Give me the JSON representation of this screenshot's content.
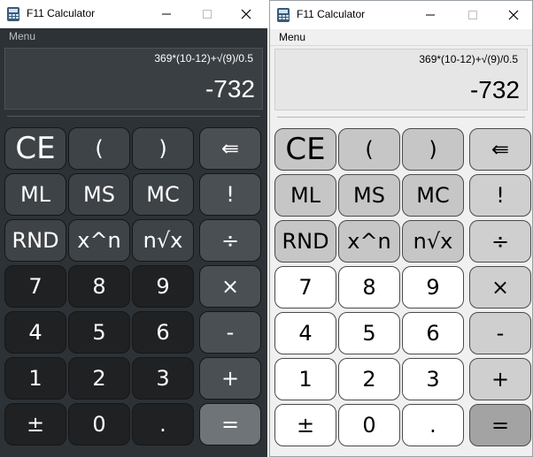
{
  "windows": [
    {
      "theme": "dark",
      "title": "F11 Calculator",
      "menu": "Menu",
      "display": {
        "expression": "369*(10-12)+√(9)/0.5",
        "result": "-732"
      },
      "keys": [
        {
          "label": "CE",
          "kind": "top"
        },
        {
          "label": "(",
          "kind": "top"
        },
        {
          "label": ")",
          "kind": "top"
        },
        {
          "label": "⇚",
          "kind": "op"
        },
        {
          "label": "ML",
          "kind": "top"
        },
        {
          "label": "MS",
          "kind": "top"
        },
        {
          "label": "MC",
          "kind": "top"
        },
        {
          "label": "!",
          "kind": "op"
        },
        {
          "label": "RND",
          "kind": "top"
        },
        {
          "label": "x^n",
          "kind": "top"
        },
        {
          "label": "n√x",
          "kind": "top"
        },
        {
          "label": "÷",
          "kind": "op"
        },
        {
          "label": "7",
          "kind": "num"
        },
        {
          "label": "8",
          "kind": "num"
        },
        {
          "label": "9",
          "kind": "num"
        },
        {
          "label": "×",
          "kind": "op"
        },
        {
          "label": "4",
          "kind": "num"
        },
        {
          "label": "5",
          "kind": "num"
        },
        {
          "label": "6",
          "kind": "num"
        },
        {
          "label": "-",
          "kind": "op"
        },
        {
          "label": "1",
          "kind": "num"
        },
        {
          "label": "2",
          "kind": "num"
        },
        {
          "label": "3",
          "kind": "num"
        },
        {
          "label": "+",
          "kind": "op"
        },
        {
          "label": "±",
          "kind": "num"
        },
        {
          "label": "0",
          "kind": "num"
        },
        {
          "label": ".",
          "kind": "num"
        },
        {
          "label": "=",
          "kind": "eq"
        }
      ]
    },
    {
      "theme": "light",
      "title": "F11 Calculator",
      "menu": "Menu",
      "display": {
        "expression": "369*(10-12)+√(9)/0.5",
        "result": "-732"
      },
      "keys": [
        {
          "label": "CE",
          "kind": "top"
        },
        {
          "label": "(",
          "kind": "top"
        },
        {
          "label": ")",
          "kind": "top"
        },
        {
          "label": "⇚",
          "kind": "op"
        },
        {
          "label": "ML",
          "kind": "top"
        },
        {
          "label": "MS",
          "kind": "top"
        },
        {
          "label": "MC",
          "kind": "top"
        },
        {
          "label": "!",
          "kind": "op"
        },
        {
          "label": "RND",
          "kind": "top"
        },
        {
          "label": "x^n",
          "kind": "top"
        },
        {
          "label": "n√x",
          "kind": "top"
        },
        {
          "label": "÷",
          "kind": "op"
        },
        {
          "label": "7",
          "kind": "num"
        },
        {
          "label": "8",
          "kind": "num"
        },
        {
          "label": "9",
          "kind": "num"
        },
        {
          "label": "×",
          "kind": "op"
        },
        {
          "label": "4",
          "kind": "num"
        },
        {
          "label": "5",
          "kind": "num"
        },
        {
          "label": "6",
          "kind": "num"
        },
        {
          "label": "-",
          "kind": "op"
        },
        {
          "label": "1",
          "kind": "num"
        },
        {
          "label": "2",
          "kind": "num"
        },
        {
          "label": "3",
          "kind": "num"
        },
        {
          "label": "+",
          "kind": "op"
        },
        {
          "label": "±",
          "kind": "num"
        },
        {
          "label": "0",
          "kind": "num"
        },
        {
          "label": ".",
          "kind": "num"
        },
        {
          "label": "=",
          "kind": "eq"
        }
      ]
    }
  ],
  "icons": {
    "app": "calculator-icon",
    "minimize": "minimize-icon",
    "maximize": "maximize-icon",
    "close": "close-icon"
  }
}
